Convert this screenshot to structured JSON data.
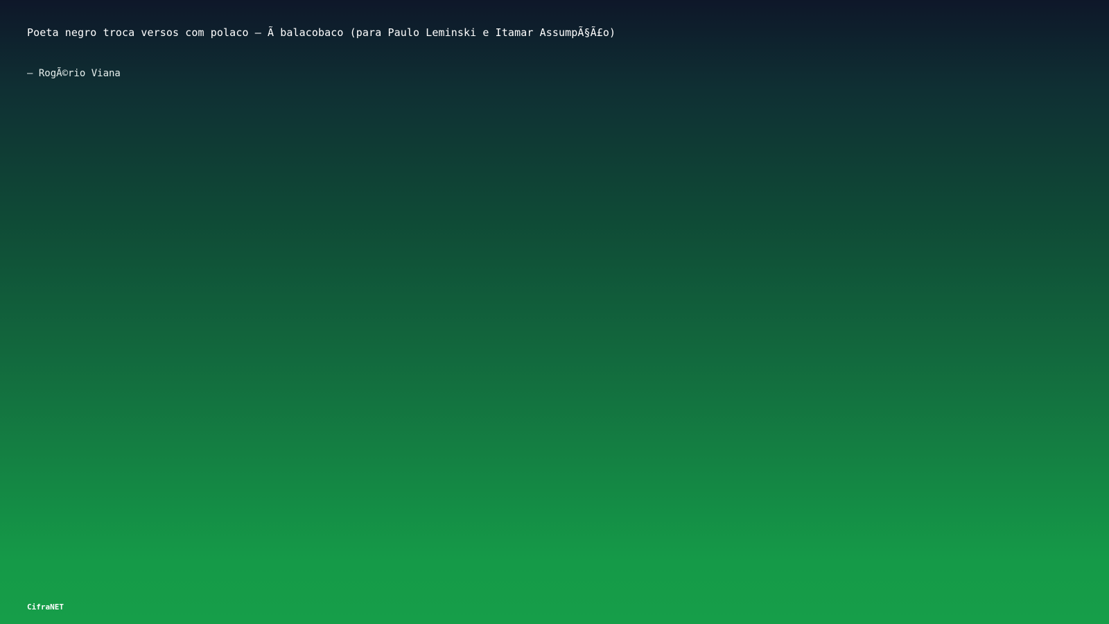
{
  "song": {
    "title": "Poeta negro troca versos com polaco – Ã balacobaco (para Paulo Leminski e Itamar AssumpÃ§Ã£o)",
    "author": "– RogÃ©rio Viana"
  },
  "footer": {
    "brand": "CifraNET"
  },
  "colors": {
    "gradient_top": "#0e1729",
    "gradient_bottom": "#169e49",
    "text": "#ffffff"
  }
}
